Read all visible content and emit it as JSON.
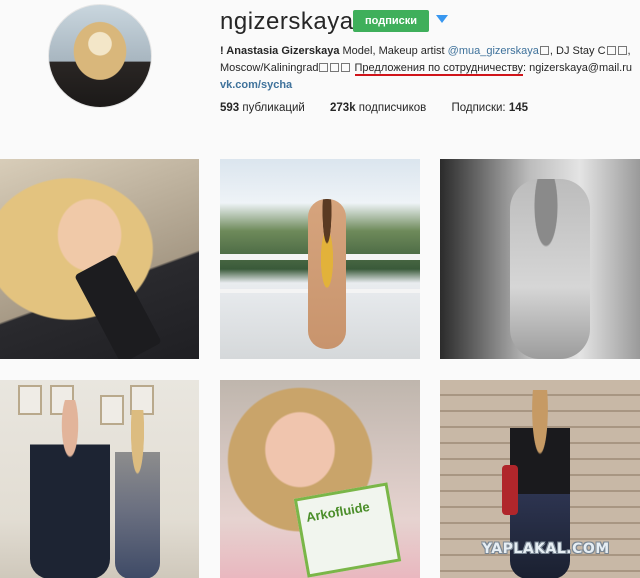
{
  "profile": {
    "username": "ngizerskaya",
    "follow_label": "подписки",
    "bio_name": "! Anastasia Gizerskaya",
    "bio_text1": " Model, Makeup artist ",
    "bio_mention": "@mua_gizerskaya",
    "bio_text2": ", DJ Stay C",
    "bio_line2_prefix": "Moscow/Kaliningrad",
    "bio_highlight": "Предложения по сотрудничеству",
    "bio_line2_suffix": ": ngizerskaya@mail.ru",
    "website": "vk.com/sycha"
  },
  "stats": {
    "posts_count": "593",
    "posts_label": " публикаций",
    "followers_count": "273k",
    "followers_label": " подписчиков",
    "following_label": "Подписки: ",
    "following_count": "145"
  },
  "photos": [
    {
      "icon": "photo-selfie-bottle"
    },
    {
      "icon": "photo-balcony-sea"
    },
    {
      "icon": "photo-bw-mirror"
    },
    {
      "icon": "photo-office-two-people"
    },
    {
      "icon": "photo-selfie-arkofluide"
    },
    {
      "icon": "photo-wood-wall"
    }
  ],
  "photo5_product": "Arkofluide",
  "watermark": "YAPLAKAL.COM",
  "colors": {
    "follow_button": "#3faf5b",
    "link": "#3f729b",
    "highlight": "#d0141a",
    "dropdown": "#3897f0"
  }
}
